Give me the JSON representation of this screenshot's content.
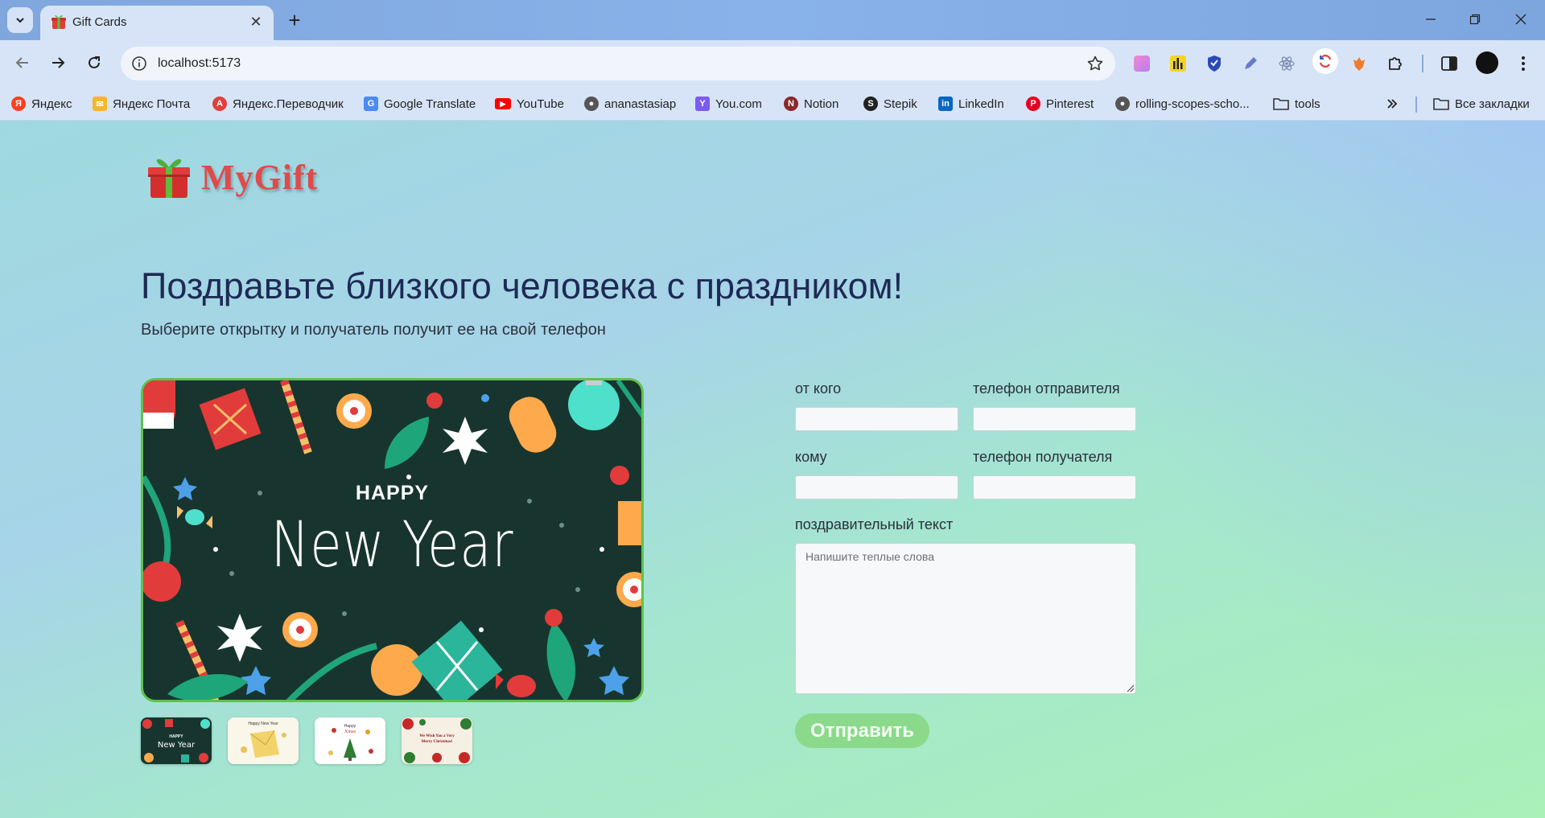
{
  "browser": {
    "tab_title": "Gift Cards",
    "url": "localhost:5173",
    "bookmarks": [
      {
        "label": "Яндекс",
        "icon": "yandex-icon",
        "color": "#fc3f1d"
      },
      {
        "label": "Яндекс Почта",
        "icon": "mail-icon",
        "color": "#f6b728"
      },
      {
        "label": "Яндекс.Переводчик",
        "icon": "translate-icon",
        "color": "#e0403a"
      },
      {
        "label": "Google Translate",
        "icon": "google-translate-icon",
        "color": "#4c8bf5"
      },
      {
        "label": "YouTube",
        "icon": "youtube-icon",
        "color": "#ff0000"
      },
      {
        "label": "ananastasiap",
        "icon": "github-icon",
        "color": "#555555"
      },
      {
        "label": "You.com",
        "icon": "youcom-icon",
        "color": "#7b5cf0"
      },
      {
        "label": "Notion",
        "icon": "notion-icon",
        "color": "#8a2a2a"
      },
      {
        "label": "Stepik",
        "icon": "stepik-icon",
        "color": "#222222"
      },
      {
        "label": "LinkedIn",
        "icon": "linkedin-icon",
        "color": "#0a66c2"
      },
      {
        "label": "Pinterest",
        "icon": "pinterest-icon",
        "color": "#e60023"
      },
      {
        "label": "rolling-scopes-scho...",
        "icon": "github-icon",
        "color": "#555555"
      },
      {
        "label": "tools",
        "icon": "folder-icon",
        "color": "#555555"
      }
    ],
    "all_bookmarks": "Все закладки"
  },
  "brand": {
    "name": "MyGift"
  },
  "hero": {
    "title": "Поздравьте близкого человека с праздником!",
    "subtitle": "Выберите открытку и получатель получит ее на свой телефон"
  },
  "card": {
    "line1": "HAPPY",
    "line2": "New Year"
  },
  "thumbnails": [
    {
      "label": "Happy New Year dark card"
    },
    {
      "label": "Happy New Year envelope card"
    },
    {
      "label": "Happy Xmas tree card"
    },
    {
      "label": "We Wish You a Very Merry Christmas card"
    }
  ],
  "form": {
    "from_label": "от кого",
    "sender_phone_label": "телефон отправителя",
    "to_label": "кому",
    "recipient_phone_label": "телефон получателя",
    "message_label": "поздравительный текст",
    "message_placeholder": "Напишите теплые слова",
    "submit_label": "Отправить"
  },
  "colors": {
    "accent": "#e04a4a",
    "submit": "#8bd98b",
    "card_border": "#5fc24a",
    "headline": "#1e2a55"
  }
}
